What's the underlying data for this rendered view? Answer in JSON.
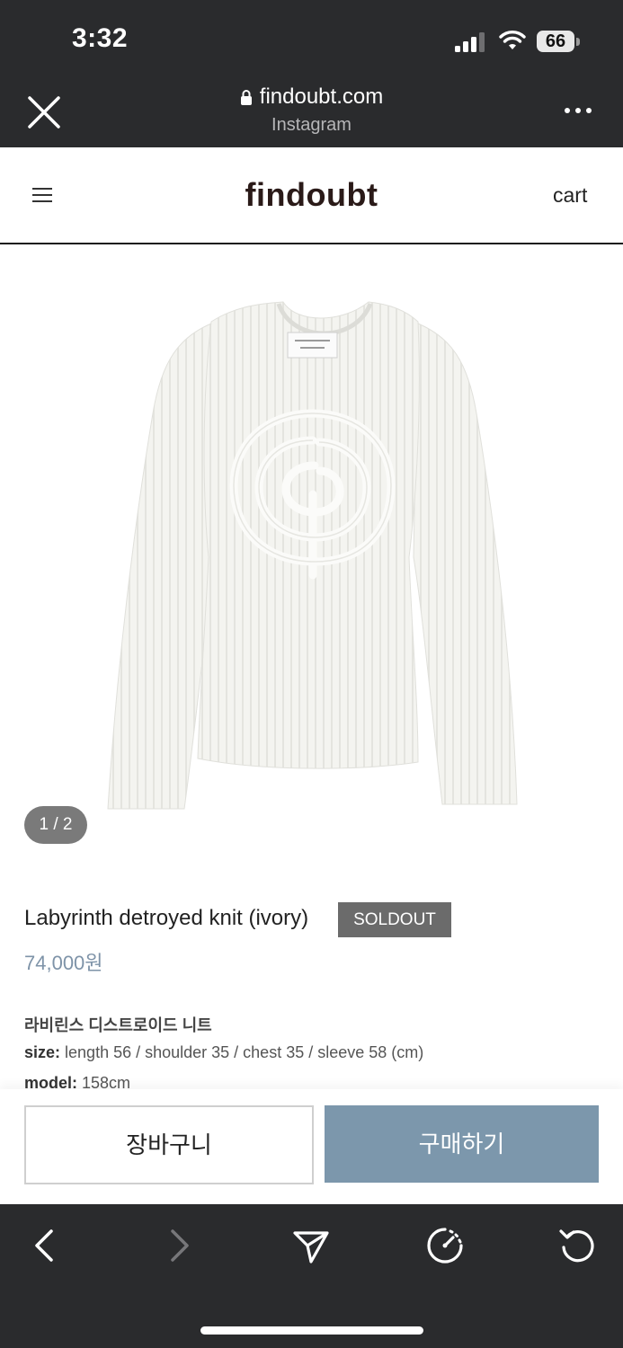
{
  "status_bar": {
    "time": "3:32",
    "battery": "66"
  },
  "browser": {
    "domain": "findoubt.com",
    "source": "Instagram"
  },
  "site": {
    "logo": "findoubt",
    "cart_label": "cart"
  },
  "product": {
    "image_counter": "1 / 2",
    "title": "Labyrinth detroyed knit (ivory)",
    "badge": "SOLDOUT",
    "price": "74,000원",
    "name_ko": "라비린스 디스트로이드 니트",
    "size_label": "size:",
    "size_value": " length 56 / shoulder 35 / chest 35 / sleeve 58 (cm)",
    "model_label": "model:",
    "model_value": " 158cm"
  },
  "actions": {
    "add_to_cart": "장바구니",
    "buy_now": "구매하기"
  },
  "colors": {
    "browser_chrome": "#2a2b2d",
    "price": "#7e93a8",
    "buy_button": "#7c97ac",
    "badge": "#6b6b6b"
  },
  "icons": {
    "close": "close-icon",
    "lock": "lock-icon",
    "more": "more-icon",
    "menu": "menu-icon",
    "back": "back-icon",
    "forward": "forward-icon",
    "share": "share-icon",
    "speed": "speedometer-icon",
    "reload": "reload-icon"
  }
}
